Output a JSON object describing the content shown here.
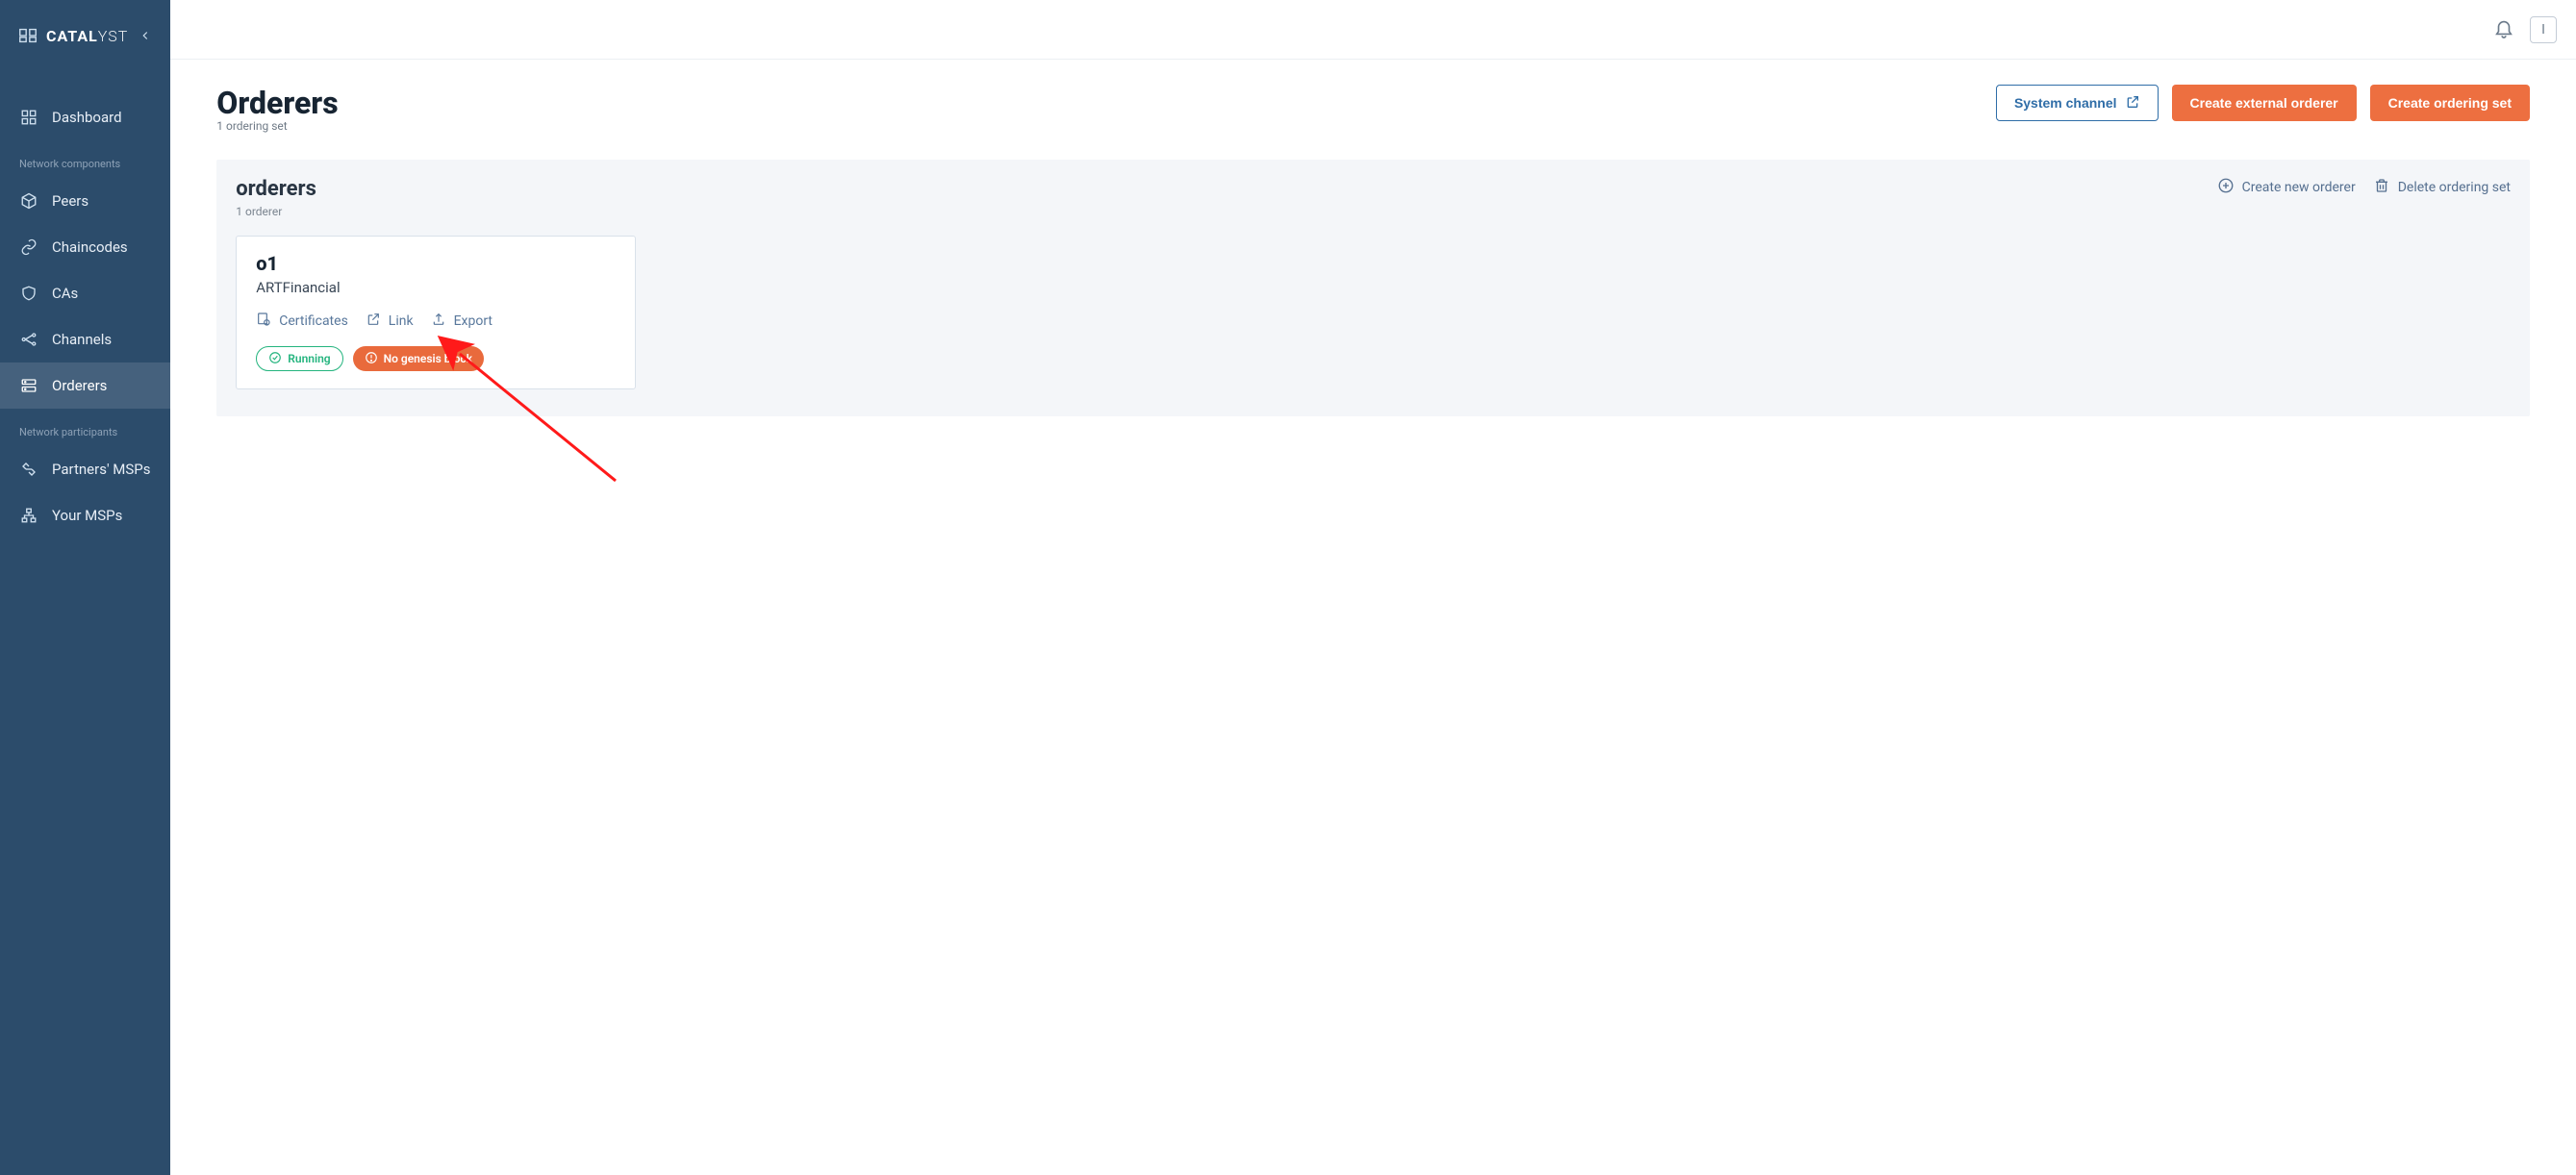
{
  "brand": {
    "name_a": "CATAL",
    "name_b": "YST"
  },
  "nav": {
    "dashboard": "Dashboard",
    "section_components": "Network components",
    "peers": "Peers",
    "chaincodes": "Chaincodes",
    "cas": "CAs",
    "channels": "Channels",
    "orderers": "Orderers",
    "section_participants": "Network participants",
    "partners_msps": "Partners' MSPs",
    "your_msps": "Your MSPs"
  },
  "topbar": {
    "avatar_initial": "I"
  },
  "page": {
    "title": "Orderers",
    "subtitle": "1 ordering set",
    "actions": {
      "system_channel": "System channel",
      "create_external": "Create external orderer",
      "create_set": "Create ordering set"
    }
  },
  "set": {
    "title": "orderers",
    "subtitle": "1 orderer",
    "actions": {
      "create_new": "Create new orderer",
      "delete_set": "Delete ordering set"
    },
    "card": {
      "name": "o1",
      "org": "ARTFinancial",
      "links": {
        "certificates": "Certificates",
        "link": "Link",
        "export": "Export"
      },
      "status_running": "Running",
      "status_no_genesis": "No genesis block"
    }
  }
}
